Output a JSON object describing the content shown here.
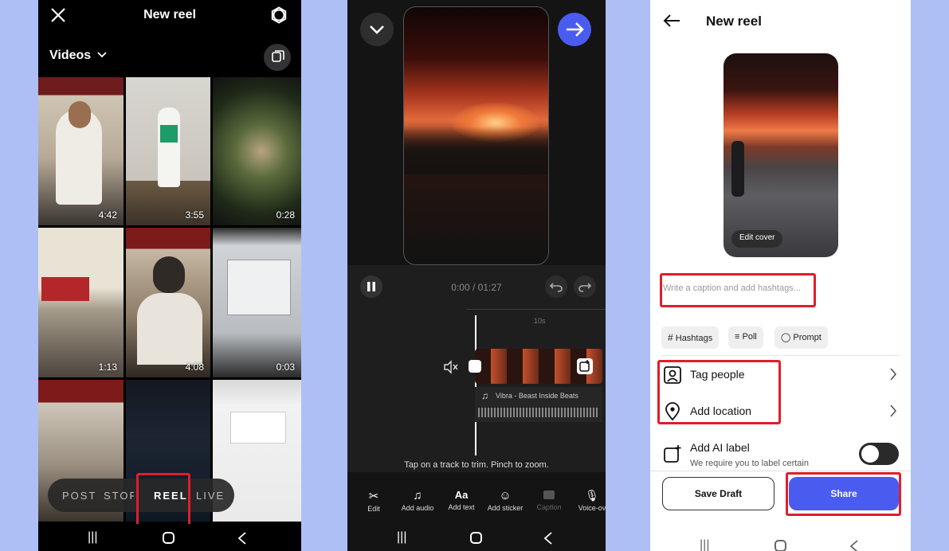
{
  "screen1": {
    "title": "New reel",
    "dropdown": "Videos",
    "durations": [
      "4:42",
      "3:55",
      "0:28",
      "1:13",
      "4:08",
      "0:03"
    ],
    "modes": [
      "POST",
      "STORY",
      "REEL",
      "LIVE"
    ],
    "active_mode": "REEL"
  },
  "screen2": {
    "time": "0:00 / 01:27",
    "ruler_mark": "10s",
    "audio_track": "Vibra - Beast Inside Beats",
    "hint": "Tap on a track to trim. Pinch to zoom.",
    "tools": [
      "Edit",
      "Add audio",
      "Add text",
      "Add sticker",
      "Caption",
      "Voice-ov"
    ]
  },
  "screen3": {
    "title": "New reel",
    "edit_cover": "Edit cover",
    "caption_placeholder": "Write a caption and add hashtags...",
    "chips": [
      "Hashtags",
      "Poll",
      "Prompt"
    ],
    "tag_people": "Tag people",
    "add_location": "Add location",
    "ai_label": "Add AI label",
    "ai_label_sub": "We require you to label certain",
    "save_draft": "Save Draft",
    "share": "Share"
  },
  "colors": {
    "accent": "#4a5cf0",
    "highlight": "#e01e2b",
    "backdrop": "#aebff5"
  }
}
